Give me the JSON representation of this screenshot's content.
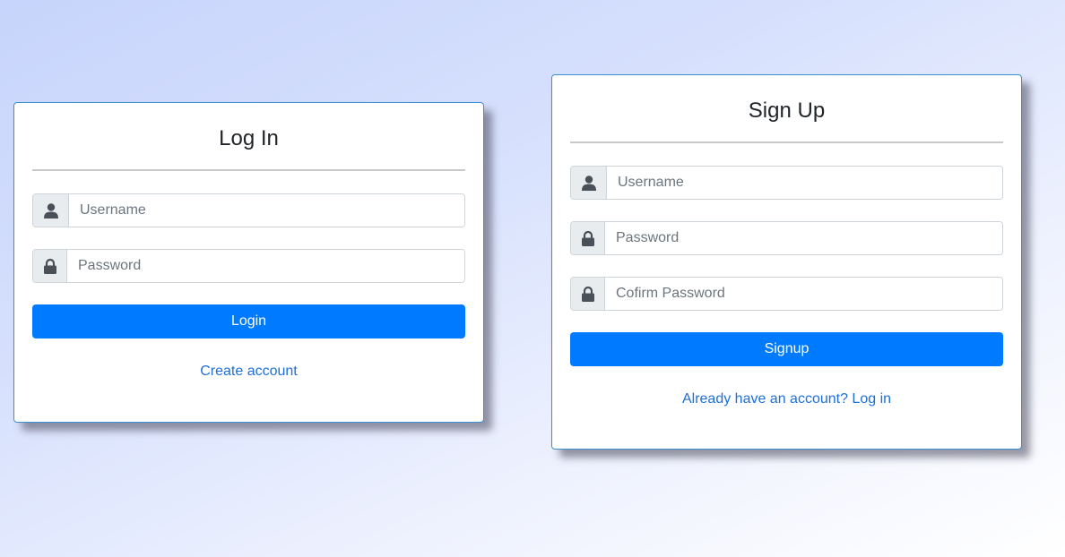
{
  "login": {
    "title": "Log In",
    "username_placeholder": "Username",
    "password_placeholder": "Password",
    "button_label": "Login",
    "link_text": "Create account",
    "icons": [
      "user-icon",
      "lock-icon"
    ]
  },
  "signup": {
    "title": "Sign Up",
    "username_placeholder": "Username",
    "password_placeholder": "Password",
    "confirm_placeholder": "Cofirm Password",
    "button_label": "Signup",
    "link_text": "Already have an account? Log in",
    "icons": [
      "user-icon",
      "lock-icon",
      "lock-icon"
    ]
  },
  "colors": {
    "primary": "#007bff",
    "link": "#1e6fd9",
    "card_border": "#3b8fd0",
    "addon_bg": "#e9ecef"
  }
}
